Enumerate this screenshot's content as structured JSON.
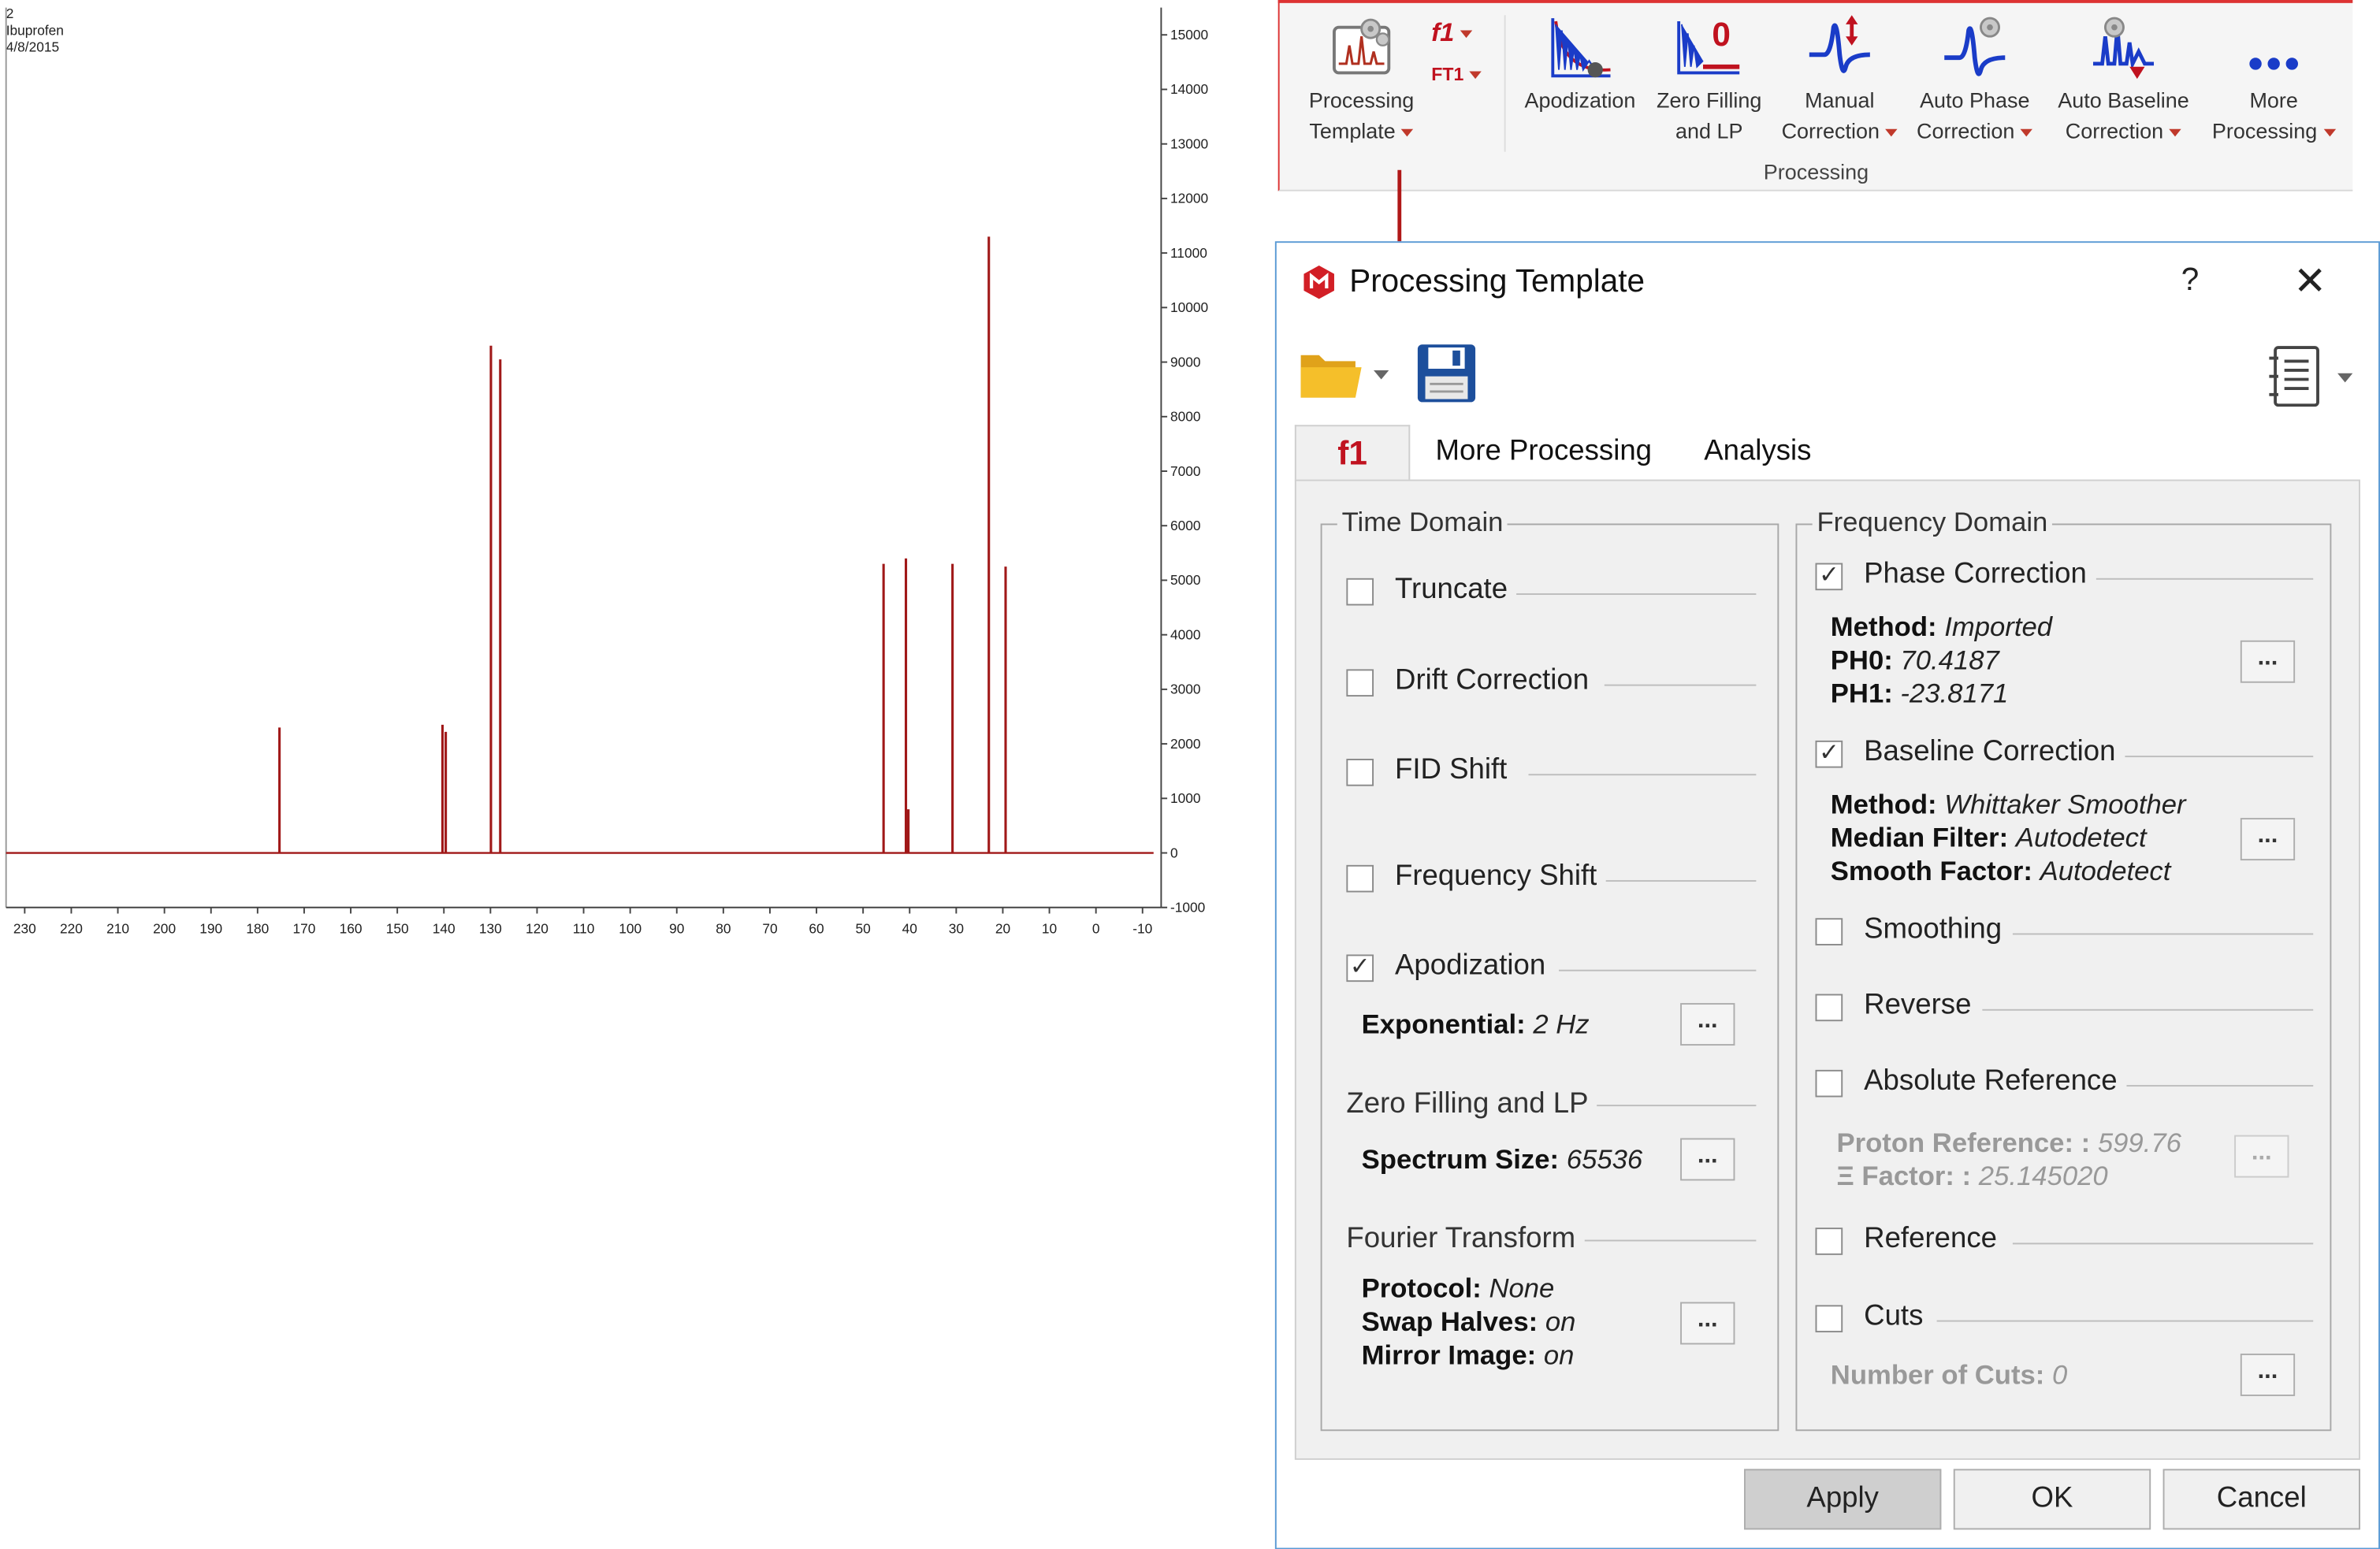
{
  "spectrum": {
    "info": [
      "2",
      "Ibuprofen",
      "4/8/2015"
    ],
    "y_ticks": [
      "15000",
      "14000",
      "13000",
      "12000",
      "11000",
      "10000",
      "9000",
      "8000",
      "7000",
      "6000",
      "5000",
      "4000",
      "3000",
      "2000",
      "1000",
      "0",
      "-1000"
    ],
    "x_ticks": [
      "230",
      "220",
      "210",
      "200",
      "190",
      "180",
      "170",
      "160",
      "150",
      "140",
      "130",
      "120",
      "110",
      "100",
      "90",
      "80",
      "70",
      "60",
      "50",
      "40",
      "30",
      "20",
      "10",
      "0",
      "-10"
    ]
  },
  "chart_data": {
    "type": "line",
    "x_range": [
      234,
      -14
    ],
    "ylim": [
      -1000,
      15500
    ],
    "peaks": [
      {
        "x": 175.3,
        "y": 2300
      },
      {
        "x": 140.3,
        "y": 2350
      },
      {
        "x": 139.6,
        "y": 2220
      },
      {
        "x": 129.9,
        "y": 9300
      },
      {
        "x": 127.9,
        "y": 9050
      },
      {
        "x": 45.6,
        "y": 5300
      },
      {
        "x": 40.8,
        "y": 5400
      },
      {
        "x": 30.8,
        "y": 5300
      },
      {
        "x": 23.0,
        "y": 11300
      },
      {
        "x": 19.4,
        "y": 5250
      }
    ],
    "solvent": {
      "x": 40.5,
      "y": 800
    }
  },
  "ribbon": {
    "processing_template": [
      "Processing",
      "Template"
    ],
    "f1": "f1",
    "ft1": "FT1",
    "apodization": [
      "Apodization",
      ""
    ],
    "zero_filling": [
      "Zero Filling",
      "and LP"
    ],
    "zero_badge": "0",
    "manual": [
      "Manual",
      "Correction"
    ],
    "auto_phase": [
      "Auto Phase",
      "Correction"
    ],
    "auto_baseline": [
      "Auto Baseline",
      "Correction"
    ],
    "more": [
      "More",
      "Processing"
    ],
    "group": "Processing"
  },
  "dialog": {
    "title": "Processing Template",
    "help": "?",
    "close": "✕",
    "tabs": [
      "f1",
      "More Processing",
      "Analysis"
    ],
    "time_domain": {
      "legend": "Time Domain",
      "truncate": "Truncate",
      "drift": "Drift Correction",
      "fid_shift": "FID Shift",
      "freq_shift": "Frequency Shift",
      "apodization": "Apodization",
      "exp_label": "Exponential:",
      "exp_value": "2 Hz",
      "zf_label": "Zero Filling and LP",
      "size_label": "Spectrum Size:",
      "size_value": "65536",
      "ft_label": "Fourier Transform",
      "protocol_label": "Protocol:",
      "protocol_value": "None",
      "swap_label": "Swap Halves:",
      "swap_value": "on",
      "mirror_label": "Mirror Image:",
      "mirror_value": "on"
    },
    "freq_domain": {
      "legend": "Frequency Domain",
      "phase": "Phase Correction",
      "method_label": "Method:",
      "phase_method": "Imported",
      "ph0_label": "PH0:",
      "ph0_value": "70.4187",
      "ph1_label": "PH1:",
      "ph1_value": "-23.8171",
      "baseline": "Baseline Correction",
      "baseline_method": "Whittaker Smoother",
      "median_label": "Median Filter:",
      "median_value": "Autodetect",
      "smooth_label": "Smooth Factor:",
      "smooth_value": "Autodetect",
      "smoothing": "Smoothing",
      "reverse": "Reverse",
      "abs_ref": "Absolute Reference",
      "proton_label": "Proton Reference: :",
      "proton_value": "599.76",
      "xi_label": "Ξ Factor: :",
      "xi_value": "25.145020",
      "reference": "Reference",
      "cuts": "Cuts",
      "num_cuts_label": "Number of Cuts:",
      "num_cuts_value": "0"
    },
    "dots": "...",
    "check_mark": "✓",
    "apply": "Apply",
    "ok": "OK",
    "cancel": "Cancel"
  }
}
